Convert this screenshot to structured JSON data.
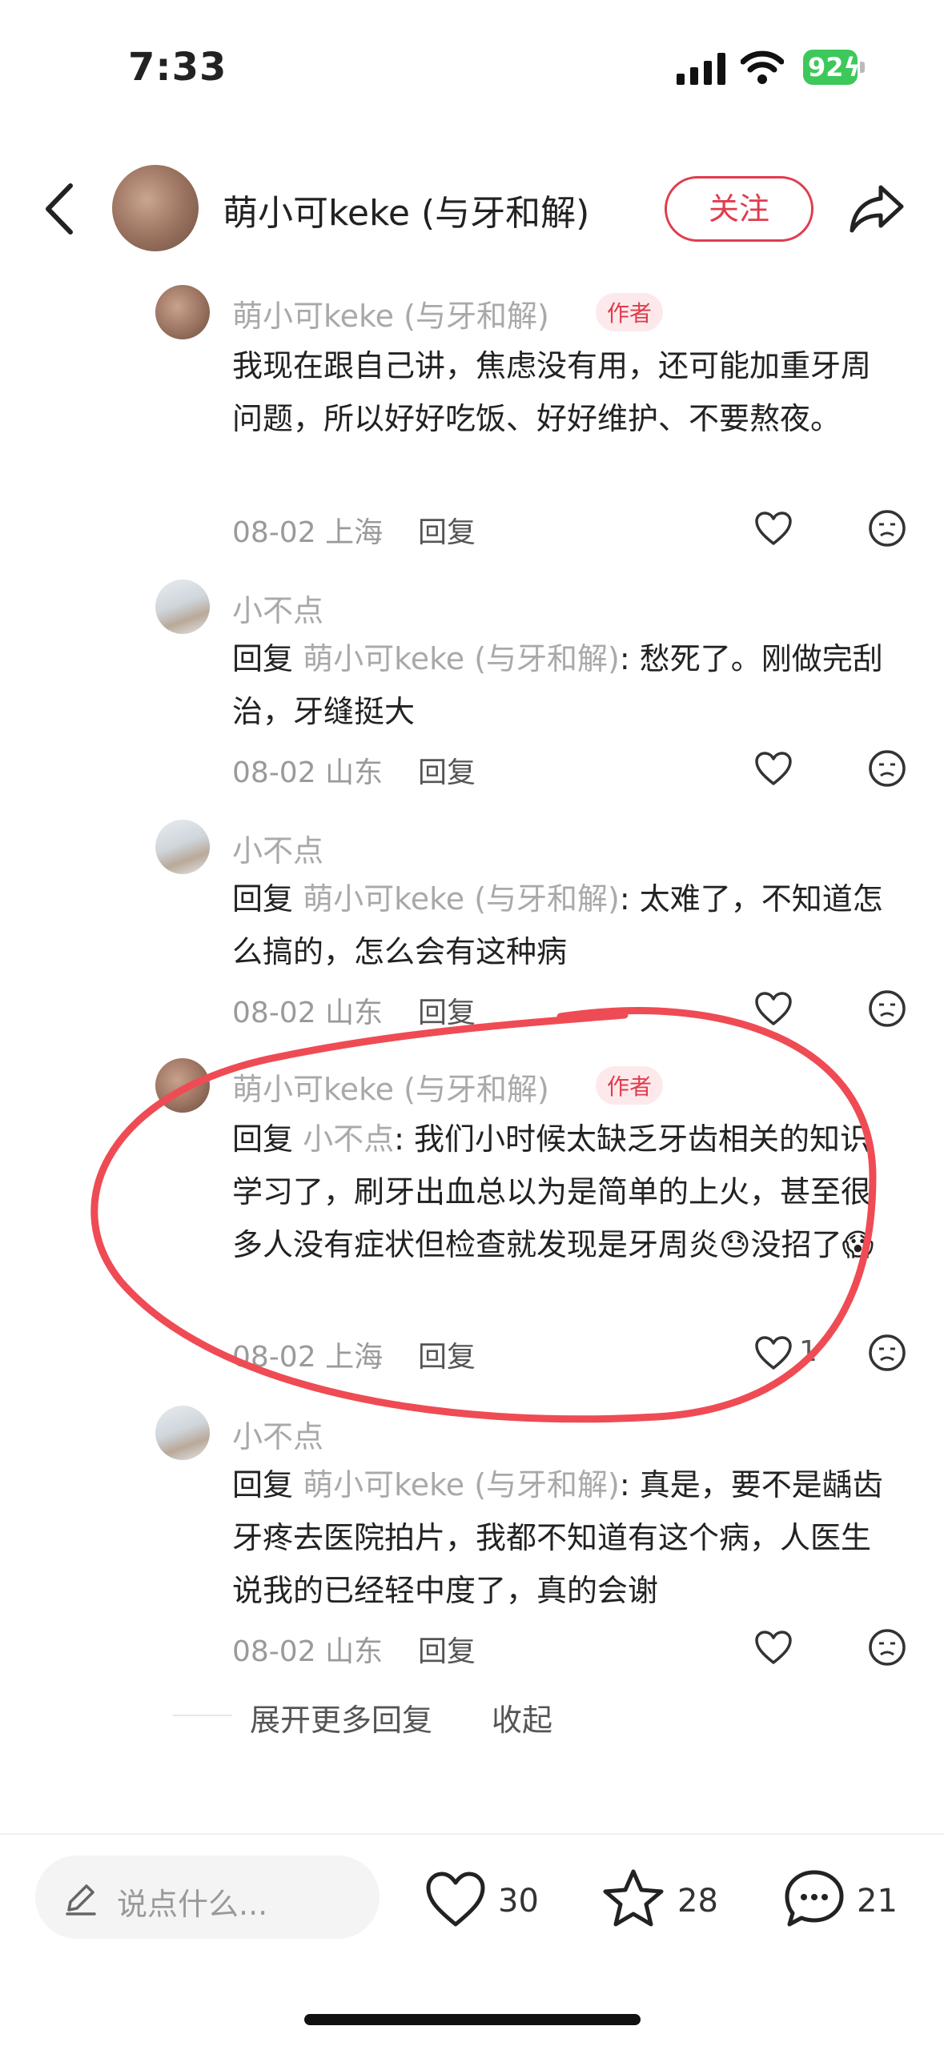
{
  "status_bar": {
    "time": "7:33",
    "battery": "92"
  },
  "header": {
    "title": "萌小可keke (与牙和解)",
    "follow_label": "关注"
  },
  "icons": {
    "back": "chevron-left-icon",
    "share": "share-arrow-icon",
    "like": "heart-icon",
    "dislike": "unhappy-face-icon",
    "star": "star-icon",
    "comment": "chat-bubble-icon",
    "edit": "pencil-icon"
  },
  "comments": [
    {
      "name": "萌小可keke (与牙和解)",
      "badge": "作者",
      "text": "我现在跟自己讲，焦虑没有用，还可能加重牙周问题，所以好好吃饭、好好维护、不要熬夜。",
      "date": "08-02",
      "location": "上海",
      "reply_label": "回复"
    },
    {
      "name": "小不点",
      "reply_prefix": "回复 ",
      "reply_to": "萌小可keke (与牙和解)",
      "text": ": 愁死了。刚做完刮治，牙缝挺大",
      "date": "08-02",
      "location": "山东",
      "reply_label": "回复"
    },
    {
      "name": "小不点",
      "reply_prefix": "回复 ",
      "reply_to": "萌小可keke (与牙和解)",
      "text": ": 太难了，不知道怎么搞的，怎么会有这种病",
      "date": "08-02",
      "location": "山东",
      "reply_label": "回复"
    },
    {
      "name": "萌小可keke (与牙和解)",
      "badge": "作者",
      "reply_prefix": "回复 ",
      "reply_to": "小不点",
      "text": ": 我们小时候太缺乏牙齿相关的知识学习了，刷牙出血总以为是简单的上火，甚至很多人没有症状但检查就发现是牙周炎😓没招了😱",
      "date": "08-02",
      "location": "上海",
      "reply_label": "回复",
      "likes": "1"
    },
    {
      "name": "小不点",
      "reply_prefix": "回复 ",
      "reply_to": "萌小可keke (与牙和解)",
      "text": ": 真是，要不是龋齿牙疼去医院拍片，我都不知道有这个病，人医生说我的已经轻中度了，真的会谢",
      "date": "08-02",
      "location": "山东",
      "reply_label": "回复"
    }
  ],
  "expand_label": "展开更多回复",
  "collapse_label": "收起",
  "bottom_bar": {
    "placeholder": "说点什么...",
    "likes": "30",
    "stars": "28",
    "comments": "21"
  },
  "annotation": {
    "color": "#ef4b54"
  }
}
